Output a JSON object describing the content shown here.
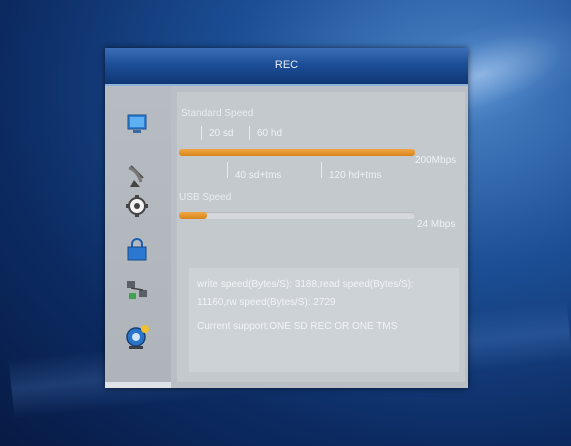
{
  "dialog": {
    "title": "REC"
  },
  "sidebar": {
    "items": [
      {
        "icon": "monitor-icon"
      },
      {
        "icon": "satellite-dish-icon"
      },
      {
        "icon": "gear-icon"
      },
      {
        "icon": "lock-icon"
      },
      {
        "icon": "network-icon"
      },
      {
        "icon": "record-icon"
      }
    ]
  },
  "standard_speed": {
    "label": "Standard Speed",
    "ticks_top": [
      "20 sd",
      "60 hd"
    ],
    "ticks_bottom": [
      "40 sd+tms",
      "120 hd+tms"
    ],
    "value_label": "200Mbps",
    "fill_fraction": 1.0
  },
  "usb_speed": {
    "label": "USB Speed",
    "value_label": "24 Mbps",
    "fill_fraction": 0.12
  },
  "info": {
    "line1": "write speed(Bytes/S): 3188,read speed(Bytes/S):",
    "line2": "11160,rw speed(Bytes/S): 2729",
    "line3": "Current support:ONE SD REC OR ONE TMS"
  },
  "colors": {
    "bar_fill": "#e08f28",
    "title_bar": "#1d4f98"
  }
}
